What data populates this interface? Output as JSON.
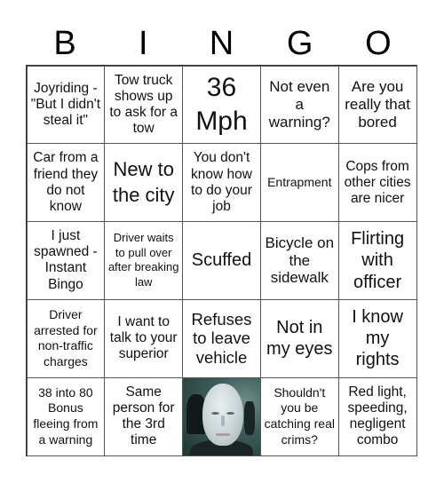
{
  "header": {
    "letters": [
      "B",
      "I",
      "N",
      "G",
      "O"
    ]
  },
  "card": {
    "rows": [
      [
        "Joyriding - \"But I didn't steal it\"",
        "Tow truck shows up to ask for a tow",
        "36 Mph",
        "Not even a warning?",
        "Are you really that bored"
      ],
      [
        "Car from a friend they do not know",
        "New to the city",
        "You don't know how to do your job",
        "Entrapment",
        "Cops from other cities are nicer"
      ],
      [
        "I just spawned - Instant Bingo",
        "Driver waits to pull over after breaking law",
        "Scuffed",
        "Bicycle on the sidewalk",
        "Flirting with officer"
      ],
      [
        "Driver arrested for non-traffic charges",
        "I want to talk to your superior",
        "Refuses to leave vehicle",
        "Not in my eyes",
        "I know my rights"
      ],
      [
        "38 into 80 Bonus fleeing from a warning",
        "Same person for the 3rd time",
        "",
        "Shouldn't you be catching real crims?",
        "Red light, speeding, negligent combo"
      ]
    ],
    "free_space": {
      "type": "image",
      "icon": "portrait-photo-icon",
      "description": "pale bald man portrait"
    }
  }
}
